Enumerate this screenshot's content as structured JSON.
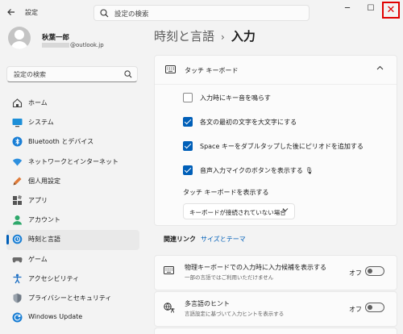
{
  "window": {
    "back_icon": "arrow-left-icon",
    "app_title": "設定",
    "search_placeholder": "設定の検索",
    "controls": {
      "minimize": "─",
      "maximize": "☐",
      "close": "✕"
    }
  },
  "profile": {
    "name": "秋葉一郎",
    "email": "@outlook.jp"
  },
  "sidebar": {
    "search_placeholder": "設定の検索",
    "items": [
      {
        "label": "ホーム",
        "icon": "home-icon"
      },
      {
        "label": "システム",
        "icon": "system-icon"
      },
      {
        "label": "Bluetooth とデバイス",
        "icon": "bluetooth-icon"
      },
      {
        "label": "ネットワークとインターネット",
        "icon": "network-icon"
      },
      {
        "label": "個人用設定",
        "icon": "personalization-icon"
      },
      {
        "label": "アプリ",
        "icon": "apps-icon"
      },
      {
        "label": "アカウント",
        "icon": "account-icon"
      },
      {
        "label": "時刻と言語",
        "icon": "time-language-icon",
        "active": true
      },
      {
        "label": "ゲーム",
        "icon": "gaming-icon"
      },
      {
        "label": "アクセシビリティ",
        "icon": "accessibility-icon"
      },
      {
        "label": "プライバシーとセキュリティ",
        "icon": "privacy-icon"
      },
      {
        "label": "Windows Update",
        "icon": "windows-update-icon"
      }
    ]
  },
  "breadcrumb": {
    "parent": "時刻と言語",
    "separator": "›",
    "current": "入力"
  },
  "touch_keyboard": {
    "title": "タッチ キーボード",
    "options": [
      {
        "label": "入力時にキー音を鳴らす",
        "checked": false
      },
      {
        "label": "各文の最初の文字を大文字にする",
        "checked": true
      },
      {
        "label": "Space キーをダブルタップした後にピリオドを追加する",
        "checked": true
      },
      {
        "label": "音声入力マイクのボタンを表示する 🎙",
        "checked": true
      }
    ],
    "show_label": "タッチ キーボードを表示する",
    "dropdown_value": "キーボードが接続されていない場合"
  },
  "related": {
    "label": "関連リンク",
    "link": "サイズとテーマ"
  },
  "hardware_keyboard": {
    "title": "物理キーボードでの入力時に入力候補を表示する",
    "subtitle": "一部の言語ではご利用いただけません",
    "toggle_label": "オフ",
    "enabled": false
  },
  "multilingual": {
    "title": "多言語のヒント",
    "subtitle": "言語設定に基づいて入力ヒントを表示する",
    "toggle_label": "オフ",
    "enabled": false
  },
  "colors": {
    "accent": "#005fb8",
    "close_highlight": "#e00000"
  }
}
